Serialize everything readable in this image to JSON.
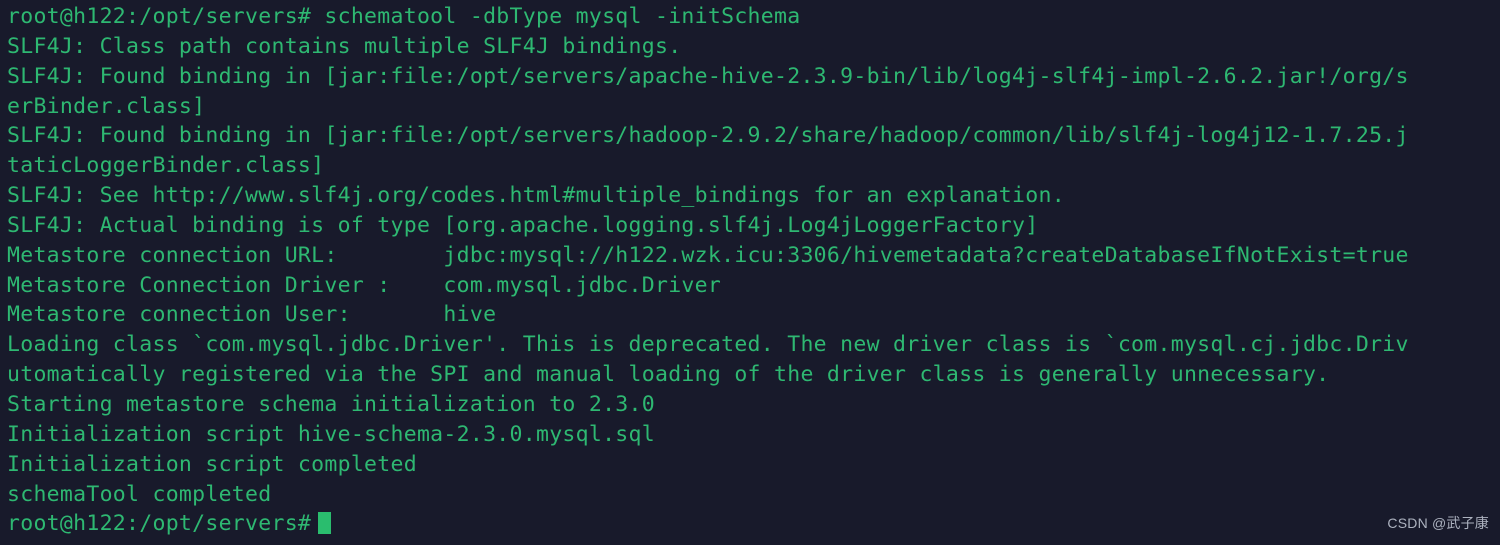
{
  "terminal": {
    "shell_prompt": "root@h122:/opt/servers#",
    "foreground_color": "#2eb872",
    "background_color": "#181a2b",
    "cursor_color": "#2abd6e",
    "columns_visible": 105,
    "lines": [
      "root@h122:/opt/servers# schematool -dbType mysql -initSchema",
      "SLF4J: Class path contains multiple SLF4J bindings.",
      "SLF4J: Found binding in [jar:file:/opt/servers/apache-hive-2.3.9-bin/lib/log4j-slf4j-impl-2.6.2.jar!/org/s",
      "erBinder.class]",
      "SLF4J: Found binding in [jar:file:/opt/servers/hadoop-2.9.2/share/hadoop/common/lib/slf4j-log4j12-1.7.25.j",
      "taticLoggerBinder.class]",
      "SLF4J: See http://www.slf4j.org/codes.html#multiple_bindings for an explanation.",
      "SLF4J: Actual binding is of type [org.apache.logging.slf4j.Log4jLoggerFactory]",
      "Metastore connection URL:\t jdbc:mysql://h122.wzk.icu:3306/hivemetadata?createDatabaseIfNotExist=true",
      "Metastore Connection Driver :\t com.mysql.jdbc.Driver",
      "Metastore connection User:\t hive",
      "Loading class `com.mysql.jdbc.Driver'. This is deprecated. The new driver class is `com.mysql.cj.jdbc.Driv",
      "utomatically registered via the SPI and manual loading of the driver class is generally unnecessary.",
      "Starting metastore schema initialization to 2.3.0",
      "Initialization script hive-schema-2.3.0.mysql.sql",
      "Initialization script completed",
      "schemaTool completed"
    ],
    "prompt_line": "root@h122:/opt/servers#",
    "cursor_glyph": "block-cursor"
  },
  "watermark": {
    "text": "CSDN @武子康"
  }
}
